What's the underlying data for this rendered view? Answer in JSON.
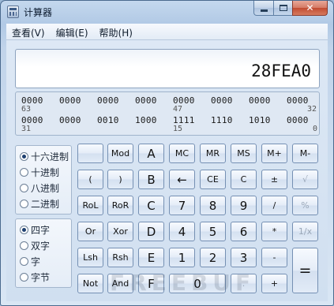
{
  "window": {
    "title": "计算器",
    "close_glyph": "✕"
  },
  "menu": [
    "查看(V)",
    "编辑(E)",
    "帮助(H)"
  ],
  "display": {
    "value": "28FEA0"
  },
  "bits": {
    "row1": [
      "0000",
      "0000",
      "0000",
      "0000",
      "0000",
      "0000",
      "0000",
      "0000"
    ],
    "row1_labels": [
      "63",
      "47",
      "32"
    ],
    "row2": [
      "0000",
      "0000",
      "0010",
      "1000",
      "1111",
      "1110",
      "1010",
      "0000"
    ],
    "row2_labels": [
      "31",
      "15",
      "0"
    ]
  },
  "base_group": {
    "selected": "十六进制",
    "options": [
      "十六进制",
      "十进制",
      "八进制",
      "二进制"
    ]
  },
  "word_group": {
    "selected": "四字",
    "options": [
      "四字",
      "双字",
      "字",
      "字节"
    ]
  },
  "buttons": {
    "row1": [
      "",
      "Mod",
      "A",
      "MC",
      "MR",
      "MS",
      "M+",
      "M-"
    ],
    "row2": [
      "(",
      ")",
      "B",
      "←",
      "CE",
      "C",
      "±",
      "√"
    ],
    "row3": [
      "RoL",
      "RoR",
      "C",
      "7",
      "8",
      "9",
      "/",
      "%"
    ],
    "row4": [
      "Or",
      "Xor",
      "D",
      "4",
      "5",
      "6",
      "*",
      "1/x"
    ],
    "row5": [
      "Lsh",
      "Rsh",
      "E",
      "1",
      "2",
      "3",
      "-",
      "="
    ],
    "row6": [
      "Not",
      "And",
      "F",
      "0",
      ".",
      "+"
    ]
  },
  "watermark": "FREEBUF"
}
